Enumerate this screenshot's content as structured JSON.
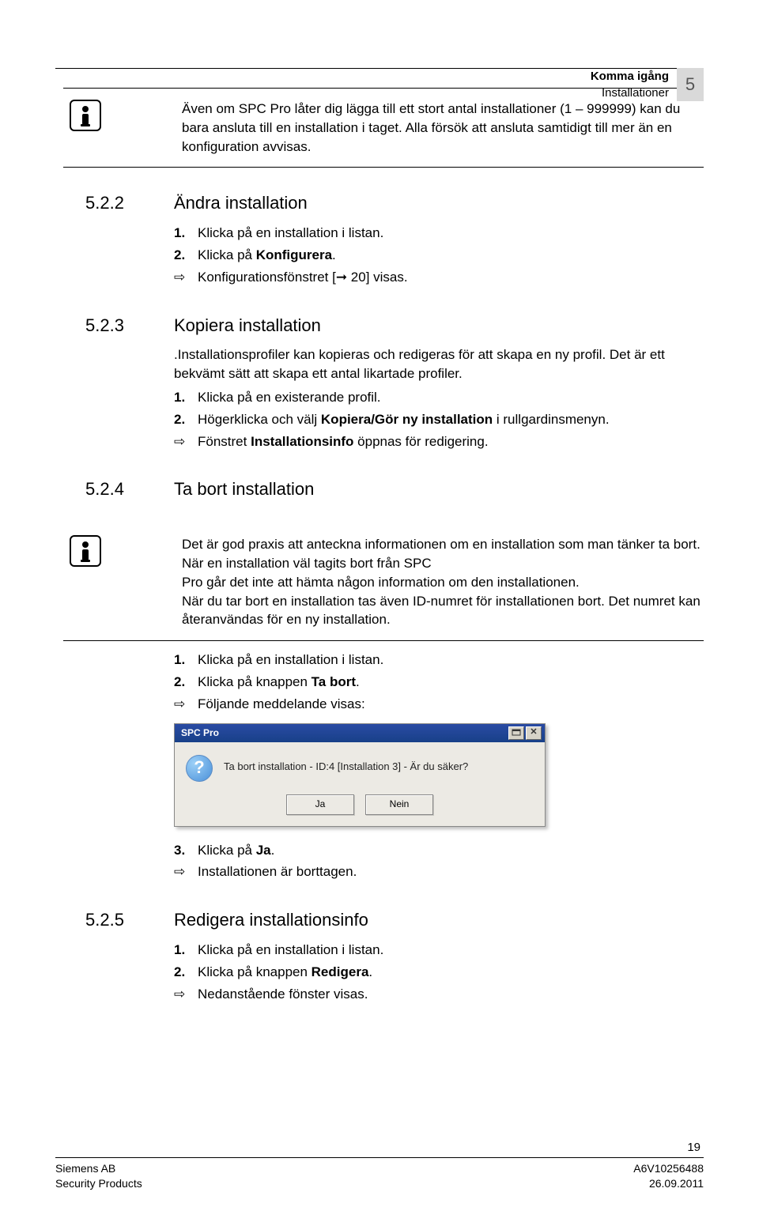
{
  "header": {
    "breadcrumb1": "Komma igång",
    "breadcrumb2": "Installationer",
    "chapter": "5"
  },
  "info1": {
    "text": "Även om SPC Pro låter dig lägga till ett stort antal installationer (1 – 999999) kan du bara ansluta till en installation i taget. Alla försök att ansluta samtidigt till mer än en konfiguration avvisas."
  },
  "s522": {
    "num": "5.2.2",
    "title": "Ändra installation",
    "step1_n": "1.",
    "step1": "Klicka på en installation i listan.",
    "step2_n": "2.",
    "step2_a": "Klicka på ",
    "step2_b": "Konfigurera",
    "step2_c": ".",
    "res_arrow": "⇨",
    "res": "Konfigurationsfönstret [➞ 20] visas."
  },
  "s523": {
    "num": "5.2.3",
    "title": "Kopiera installation",
    "intro": ".Installationsprofiler kan kopieras och redigeras för att skapa en ny profil. Det är ett bekvämt sätt att skapa ett antal likartade profiler.",
    "step1_n": "1.",
    "step1": "Klicka på en existerande profil.",
    "step2_n": "2.",
    "step2_a": "Högerklicka och välj ",
    "step2_b": "Kopiera/Gör ny installation",
    "step2_c": " i rullgardinsmenyn.",
    "res_arrow": "⇨",
    "res_a": "Fönstret ",
    "res_b": "Installationsinfo",
    "res_c": " öppnas för redigering."
  },
  "s524": {
    "num": "5.2.4",
    "title": "Ta bort installation",
    "info_p1": "Det är god praxis att anteckna informationen om en installation som man tänker ta bort. När en installation väl tagits bort från SPC",
    "info_p2": "Pro går det inte att hämta någon information om den installationen.",
    "info_p3": "När du tar bort en installation tas även ID-numret för installationen bort. Det numret kan återanvändas för en ny installation.",
    "step1_n": "1.",
    "step1": "Klicka på en installation i listan.",
    "step2_n": "2.",
    "step2_a": "Klicka på knappen ",
    "step2_b": "Ta bort",
    "step2_c": ".",
    "res_arrow": "⇨",
    "res": "Följande meddelande visas:",
    "dialog": {
      "title": "SPC Pro",
      "help": "?",
      "close": "✕",
      "msg": "Ta bort installation - ID:4 [Installation 3]  -  Är du säker?",
      "yes": "Ja",
      "no": "Nein",
      "q": "?"
    },
    "step3_n": "3.",
    "step3_a": "Klicka på ",
    "step3_b": "Ja",
    "step3_c": ".",
    "res2_arrow": "⇨",
    "res2": "Installationen är borttagen."
  },
  "s525": {
    "num": "5.2.5",
    "title": "Redigera installationsinfo",
    "step1_n": "1.",
    "step1": "Klicka på en installation i listan.",
    "step2_n": "2.",
    "step2_a": "Klicka på knappen ",
    "step2_b": "Redigera",
    "step2_c": ".",
    "res_arrow": "⇨",
    "res": "Nedanstående fönster visas."
  },
  "footer": {
    "page": "19",
    "left1": "Siemens AB",
    "left2": "Security Products",
    "right1": "A6V10256488",
    "right2": "26.09.2011"
  }
}
